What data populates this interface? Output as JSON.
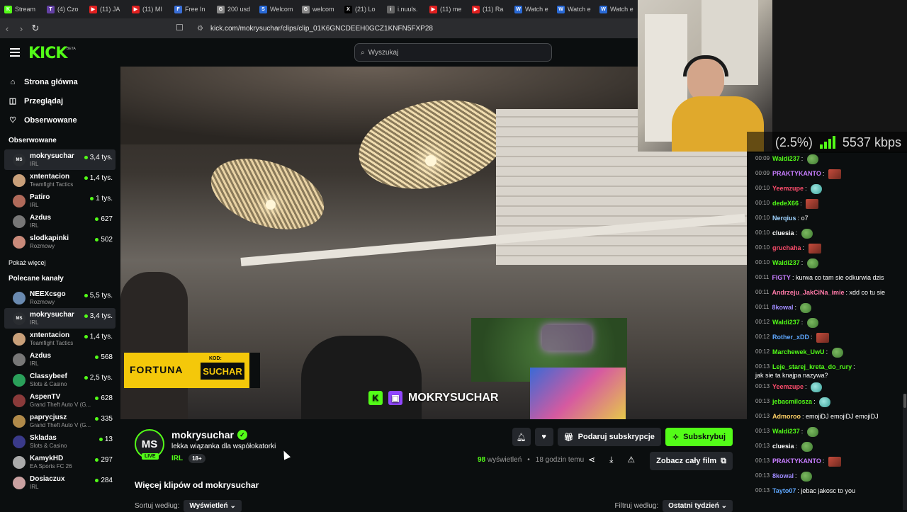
{
  "browser": {
    "tabs": [
      {
        "label": "Stream",
        "color": "#53fc18",
        "glyph": "K"
      },
      {
        "label": "(4) Czo",
        "color": "#6441a5",
        "glyph": "T"
      },
      {
        "label": "(11) JA",
        "color": "#e02020",
        "glyph": "▶"
      },
      {
        "label": "(11) MI",
        "color": "#e02020",
        "glyph": "▶"
      },
      {
        "label": "Free In",
        "color": "#3b6fd6",
        "glyph": "F"
      },
      {
        "label": "200 usd",
        "color": "#888888",
        "glyph": "G"
      },
      {
        "label": "Welcom",
        "color": "#2a6ad6",
        "glyph": "S"
      },
      {
        "label": "welcom",
        "color": "#888888",
        "glyph": "G"
      },
      {
        "label": "(21) Lo",
        "color": "#000000",
        "glyph": "X"
      },
      {
        "label": "i.nuuls.",
        "color": "#666666",
        "glyph": "i"
      },
      {
        "label": "(11) me",
        "color": "#e02020",
        "glyph": "▶"
      },
      {
        "label": "(11) Ra",
        "color": "#e02020",
        "glyph": "▶"
      },
      {
        "label": "Watch e",
        "color": "#2a6ad6",
        "glyph": "W"
      },
      {
        "label": "Watch e",
        "color": "#2a6ad6",
        "glyph": "W"
      },
      {
        "label": "Watch e",
        "color": "#2a6ad6",
        "glyph": "W"
      }
    ],
    "url": "kick.com/mokrysuchar/clips/clip_01K6GNCDEEH0GCZ1KNFN5FXP28"
  },
  "header": {
    "logo": "KICK",
    "beta": "BETA",
    "search_placeholder": "Wyszukaj"
  },
  "sidebar": {
    "nav": [
      {
        "label": "Strona główna",
        "icon": "⌂"
      },
      {
        "label": "Przeglądaj",
        "icon": "◫"
      },
      {
        "label": "Obserwowane",
        "icon": "♡"
      }
    ],
    "followed_title": "Obserwowane",
    "followed": [
      {
        "name": "mokrysuchar",
        "cat": "IRL",
        "views": "3,4 tys.",
        "av": "#2a2d31",
        "initials": "MS",
        "active": true
      },
      {
        "name": "xntentacion",
        "cat": "Teamfight Tactics",
        "views": "1,4 tys.",
        "av": "#c9a07a",
        "initials": ""
      },
      {
        "name": "Patiro",
        "cat": "IRL",
        "views": "1 tys.",
        "av": "#b06a5a",
        "initials": ""
      },
      {
        "name": "Azdus",
        "cat": "IRL",
        "views": "627",
        "av": "#777777",
        "initials": ""
      },
      {
        "name": "slodkapinki",
        "cat": "Rozmowy",
        "views": "502",
        "av": "#c98a7a",
        "initials": ""
      }
    ],
    "show_more": "Pokaż więcej",
    "recommended_title": "Polecane kanały",
    "recommended": [
      {
        "name": "NEEXcsgo",
        "cat": "Rozmowy",
        "views": "5,5 tys.",
        "av": "#6a8ab0",
        "initials": ""
      },
      {
        "name": "mokrysuchar",
        "cat": "IRL",
        "views": "3,4 tys.",
        "av": "#2a2d31",
        "initials": "MS",
        "active": true
      },
      {
        "name": "xntentacion",
        "cat": "Teamfight Tactics",
        "views": "1,4 tys.",
        "av": "#c9a07a",
        "initials": ""
      },
      {
        "name": "Azdus",
        "cat": "IRL",
        "views": "568",
        "av": "#777777",
        "initials": ""
      },
      {
        "name": "Classybeef",
        "cat": "Slots & Casino",
        "views": "2,5 tys.",
        "av": "#2aa05a",
        "initials": ""
      },
      {
        "name": "AspenTV",
        "cat": "Grand Theft Auto V (G...",
        "views": "628",
        "av": "#8a3a3a",
        "initials": ""
      },
      {
        "name": "paprycjusz",
        "cat": "Grand Theft Auto V (G...",
        "views": "335",
        "av": "#b08a4a",
        "initials": ""
      },
      {
        "name": "Skladas",
        "cat": "Slots & Casino",
        "views": "13",
        "av": "#3a3a8a",
        "initials": ""
      },
      {
        "name": "KamykHD",
        "cat": "EA Sports FC 26",
        "views": "297",
        "av": "#aaaaaa",
        "initials": ""
      },
      {
        "name": "Dosiaczux",
        "cat": "IRL",
        "views": "284",
        "av": "#c9a0a0",
        "initials": ""
      }
    ]
  },
  "player": {
    "overlay_name": "MOKRYSUCHAR",
    "sponsor_brand": "FORTUNA",
    "sponsor_kod": "KOD:",
    "sponsor_code": "SUCHAR"
  },
  "clip": {
    "initials": "MS",
    "live": "LIVE",
    "streamer": "mokrysuchar",
    "title": "lekka wiązanka dla współokatorki",
    "category": "IRL",
    "age": "18+",
    "gift_label": "Podaruj subskrypcje",
    "subscribe_label": "Subskrybuj",
    "views_count": "98",
    "views_label": "wyświetleń",
    "time_ago": "18 godzin temu",
    "full_film_label": "Zobacz cały film",
    "more_clips": "Więcej klipów od mokrysuchar",
    "sort_label": "Sortuj według:",
    "sort_value": "Wyświetleń",
    "filter_label": "Filtruj według:",
    "filter_value": "Ostatni tydzień"
  },
  "overlay_stats": {
    "pct": "(2.5%)",
    "bitrate": "5537 kbps"
  },
  "chat": [
    {
      "ts": "00:09",
      "user": "Waldi237",
      "color": "#53fc18",
      "text": "",
      "emo": "frog"
    },
    {
      "ts": "00:09",
      "user": "PRAKTYKANTO",
      "color": "#c77dff",
      "text": "",
      "emo": "red"
    },
    {
      "ts": "00:10",
      "user": "Yeemzupe",
      "color": "#ff4d6d",
      "text": "",
      "emo": "cyan"
    },
    {
      "ts": "00:10",
      "user": "dedeX66",
      "color": "#53fc18",
      "text": "",
      "emo": "red"
    },
    {
      "ts": "00:10",
      "user": "Nerqius",
      "color": "#9fd3ff",
      "text": "o7",
      "emo": ""
    },
    {
      "ts": "00:10",
      "user": "cluesia",
      "color": "#ffffff",
      "text": "",
      "emo": "frog"
    },
    {
      "ts": "00:10",
      "user": "gruchaha",
      "color": "#ff4d6d",
      "text": "",
      "emo": "red"
    },
    {
      "ts": "00:10",
      "user": "Waldi237",
      "color": "#53fc18",
      "text": "",
      "emo": "frog"
    },
    {
      "ts": "00:11",
      "user": "FIGTY",
      "color": "#c77dff",
      "text": "kurwa co tam sie odkurwia dzis",
      "emo": ""
    },
    {
      "ts": "00:11",
      "user": "Andrzeju_JakCiNa_imie",
      "color": "#ff7aa8",
      "text": "xdd co tu sie",
      "emo": ""
    },
    {
      "ts": "00:11",
      "user": "8kowal",
      "color": "#9f8bff",
      "text": "",
      "emo": "frog"
    },
    {
      "ts": "00:12",
      "user": "Waldi237",
      "color": "#53fc18",
      "text": "",
      "emo": "frog"
    },
    {
      "ts": "00:12",
      "user": "Rother_xDD",
      "color": "#5fa8ff",
      "text": "",
      "emo": "red"
    },
    {
      "ts": "00:12",
      "user": "Marchewek_UwU",
      "color": "#53fc18",
      "text": "",
      "emo": "frog"
    },
    {
      "ts": "00:13",
      "user": "Leje_starej_kreta_do_rury",
      "color": "#53fc18",
      "text": "jak sie ta knajpa nazywa?",
      "emo": ""
    },
    {
      "ts": "00:13",
      "user": "Yeemzupe",
      "color": "#ff4d6d",
      "text": "",
      "emo": "cyan"
    },
    {
      "ts": "00:13",
      "user": "jebacmilosza",
      "color": "#53fc18",
      "text": "",
      "emo": "cyan"
    },
    {
      "ts": "00:13",
      "user": "Admoroo",
      "color": "#ffd166",
      "text": "emojiDJ emojiDJ emojiDJ",
      "emo": ""
    },
    {
      "ts": "00:13",
      "user": "Waldi237",
      "color": "#53fc18",
      "text": "",
      "emo": "frog"
    },
    {
      "ts": "00:13",
      "user": "cluesia",
      "color": "#ffffff",
      "text": "",
      "emo": "frog"
    },
    {
      "ts": "00:13",
      "user": "PRAKTYKANTO",
      "color": "#c77dff",
      "text": "",
      "emo": "red"
    },
    {
      "ts": "00:13",
      "user": "8kowal",
      "color": "#9f8bff",
      "text": "",
      "emo": "frog"
    },
    {
      "ts": "00:13",
      "user": "Tayto07",
      "color": "#5fa8ff",
      "text": "jebac jakosc to you",
      "emo": ""
    }
  ]
}
